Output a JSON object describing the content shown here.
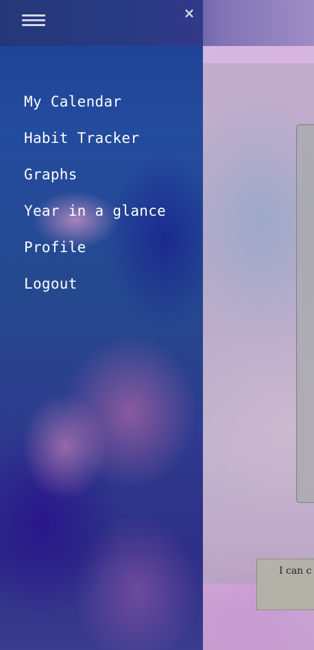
{
  "nav": {
    "menu_icon": "hamburger-icon",
    "close_icon": "close-icon",
    "close_glyph": "×",
    "items": [
      {
        "label": "My Calendar"
      },
      {
        "label": "Habit Tracker"
      },
      {
        "label": "Graphs"
      },
      {
        "label": "Year in a glance"
      },
      {
        "label": "Profile"
      },
      {
        "label": "Logout"
      }
    ]
  },
  "main": {
    "note_text": "I can c"
  },
  "colors": {
    "drawer_background": "#234b9e",
    "menu_text": "#ffffff",
    "page_background": "#c8a9d6"
  }
}
